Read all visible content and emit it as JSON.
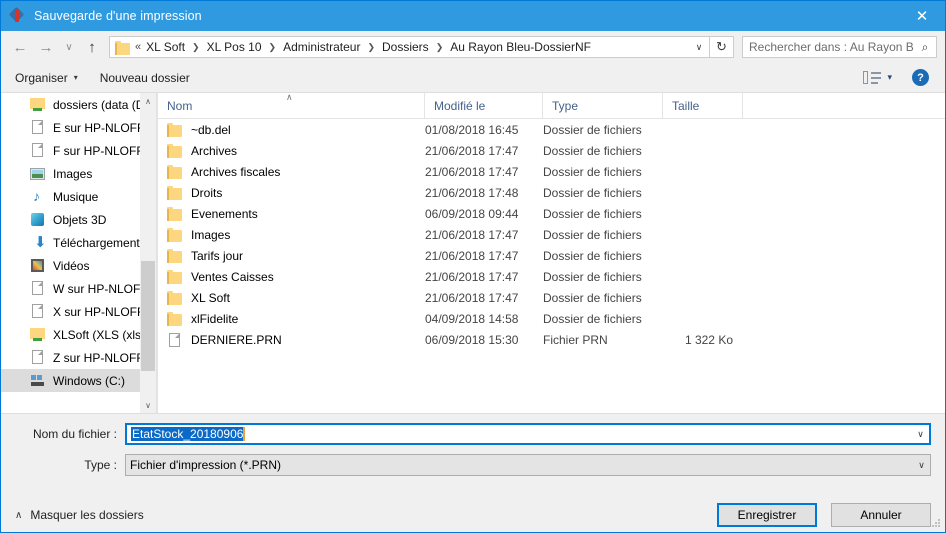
{
  "window": {
    "title": "Sauvegarde d'une impression",
    "title_icon": "app-diamond-icon",
    "close_label": "✕",
    "accent_color": "#2f9ae0",
    "border_color": "#0078d7"
  },
  "nav": {
    "back_label": "←",
    "forward_label": "→",
    "recent_label": "∨",
    "up_label": "↑",
    "refresh_label": "↻",
    "breadcrumb_lead": "«",
    "breadcrumb_separator": "❯",
    "breadcrumb": [
      "XL Soft",
      "XL Pos 10",
      "Administrateur",
      "Dossiers",
      "Au Rayon Bleu-DossierNF"
    ],
    "breadcrumb_dropdown": "∨",
    "search_placeholder": "Rechercher dans : Au Rayon B...",
    "search_icon": "⌕"
  },
  "commandbar": {
    "organize_label": "Organiser",
    "organize_caret": "▾",
    "new_folder_label": "Nouveau dossier",
    "view_caret": "▾",
    "help_label": "?"
  },
  "sidebar": {
    "scroll_up": "∧",
    "scroll_down": "∨",
    "items": [
      {
        "label": "dossiers (data (D",
        "icon": "network-folder-icon",
        "selected": false
      },
      {
        "label": "E sur HP-NLOFF",
        "icon": "document-icon",
        "selected": false
      },
      {
        "label": "F sur HP-NLOFF",
        "icon": "document-icon",
        "selected": false
      },
      {
        "label": "Images",
        "icon": "pictures-icon",
        "selected": false
      },
      {
        "label": "Musique",
        "icon": "music-icon",
        "selected": false
      },
      {
        "label": "Objets 3D",
        "icon": "objects3d-icon",
        "selected": false
      },
      {
        "label": "Téléchargement",
        "icon": "downloads-icon",
        "selected": false
      },
      {
        "label": "Vidéos",
        "icon": "videos-icon",
        "selected": false
      },
      {
        "label": "W sur HP-NLOFI",
        "icon": "document-icon",
        "selected": false
      },
      {
        "label": "X sur HP-NLOFF",
        "icon": "document-icon",
        "selected": false
      },
      {
        "label": "XLSoft (XLS (xls)",
        "icon": "network-folder-icon",
        "selected": false
      },
      {
        "label": "Z sur HP-NLOFF",
        "icon": "document-icon",
        "selected": false
      },
      {
        "label": "Windows (C:)",
        "icon": "computer-icon",
        "selected": true
      }
    ]
  },
  "filelist": {
    "columns": [
      {
        "key": "name",
        "label": "Nom"
      },
      {
        "key": "date",
        "label": "Modifié le"
      },
      {
        "key": "type",
        "label": "Type"
      },
      {
        "key": "size",
        "label": "Taille"
      }
    ],
    "sort_indicator": "∧",
    "sort_column": "Nom",
    "rows": [
      {
        "name": "~db.del",
        "date": "01/08/2018 16:45",
        "type": "Dossier de fichiers",
        "size": "",
        "icon": "folder-icon"
      },
      {
        "name": "Archives",
        "date": "21/06/2018 17:47",
        "type": "Dossier de fichiers",
        "size": "",
        "icon": "folder-icon"
      },
      {
        "name": "Archives fiscales",
        "date": "21/06/2018 17:47",
        "type": "Dossier de fichiers",
        "size": "",
        "icon": "folder-icon"
      },
      {
        "name": "Droits",
        "date": "21/06/2018 17:48",
        "type": "Dossier de fichiers",
        "size": "",
        "icon": "folder-icon"
      },
      {
        "name": "Evenements",
        "date": "06/09/2018 09:44",
        "type": "Dossier de fichiers",
        "size": "",
        "icon": "folder-icon"
      },
      {
        "name": "Images",
        "date": "21/06/2018 17:47",
        "type": "Dossier de fichiers",
        "size": "",
        "icon": "folder-icon"
      },
      {
        "name": "Tarifs jour",
        "date": "21/06/2018 17:47",
        "type": "Dossier de fichiers",
        "size": "",
        "icon": "folder-icon"
      },
      {
        "name": "Ventes Caisses",
        "date": "21/06/2018 17:47",
        "type": "Dossier de fichiers",
        "size": "",
        "icon": "folder-icon"
      },
      {
        "name": "XL Soft",
        "date": "21/06/2018 17:47",
        "type": "Dossier de fichiers",
        "size": "",
        "icon": "folder-icon"
      },
      {
        "name": "xlFidelite",
        "date": "04/09/2018 14:58",
        "type": "Dossier de fichiers",
        "size": "",
        "icon": "folder-icon"
      },
      {
        "name": "DERNIERE.PRN",
        "date": "06/09/2018 15:30",
        "type": "Fichier PRN",
        "size": "1 322 Ko",
        "icon": "file-icon"
      }
    ]
  },
  "footer": {
    "filename_label": "Nom du fichier :",
    "filename_value": "EtatStock_20180906",
    "filename_caret": "∨",
    "type_label": "Type :",
    "type_value": "Fichier d'impression (*.PRN)",
    "type_caret": "∨",
    "hide_folders_caret": "∧",
    "hide_folders_label": "Masquer les dossiers",
    "save_label": "Enregistrer",
    "cancel_label": "Annuler"
  }
}
